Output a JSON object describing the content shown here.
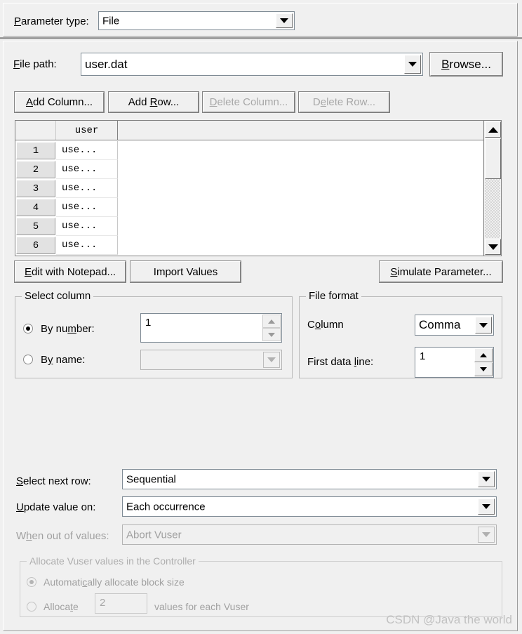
{
  "top": {
    "parameter_type_label": "Parameter type:",
    "parameter_type_value": "File"
  },
  "file": {
    "file_path_label": "File path:",
    "file_path_value": "user.dat",
    "browse_label": "Browse..."
  },
  "table_toolbar": {
    "add_column": "Add Column...",
    "add_row": "Add Row...",
    "delete_column": "Delete Column...",
    "delete_row": "Delete Row..."
  },
  "grid": {
    "columns": [
      "user"
    ],
    "rows": [
      {
        "num": "1",
        "user": "use..."
      },
      {
        "num": "2",
        "user": "use..."
      },
      {
        "num": "3",
        "user": "use..."
      },
      {
        "num": "4",
        "user": "use..."
      },
      {
        "num": "5",
        "user": "use..."
      },
      {
        "num": "6",
        "user": "use..."
      }
    ]
  },
  "actions": {
    "edit_with_notepad": "Edit with Notepad...",
    "import_values": "Import Values",
    "simulate_parameter": "Simulate Parameter..."
  },
  "select_column": {
    "caption": "Select column",
    "by_number_label": "By number:",
    "by_number_value": "1",
    "by_number_selected": true,
    "by_name_label": "By name:",
    "by_name_value": "",
    "by_name_selected": false
  },
  "file_format": {
    "caption": "File format",
    "column_label": "Column",
    "column_value": "Comma",
    "first_data_line_label": "First data line:",
    "first_data_line_value": "1"
  },
  "row_options": {
    "select_next_row_label": "Select next row:",
    "select_next_row_value": "Sequential",
    "update_value_on_label": "Update value on:",
    "update_value_on_value": "Each occurrence",
    "when_out_of_values_label": "When out of values:",
    "when_out_of_values_value": "Abort Vuser"
  },
  "allocate": {
    "caption": "Allocate Vuser values in the Controller",
    "auto_label": "Automatically allocate block size",
    "auto_selected": true,
    "allocate_label": "Allocate",
    "allocate_value": "2",
    "allocate_suffix": "values for each Vuser",
    "allocate_selected": false
  },
  "watermark": "CSDN @Java the world",
  "colors": {
    "window_bg": "#f0f0f0",
    "field_bg": "#ffffff",
    "border": "#7f8b95",
    "disabled_text": "#a8a8a8"
  }
}
